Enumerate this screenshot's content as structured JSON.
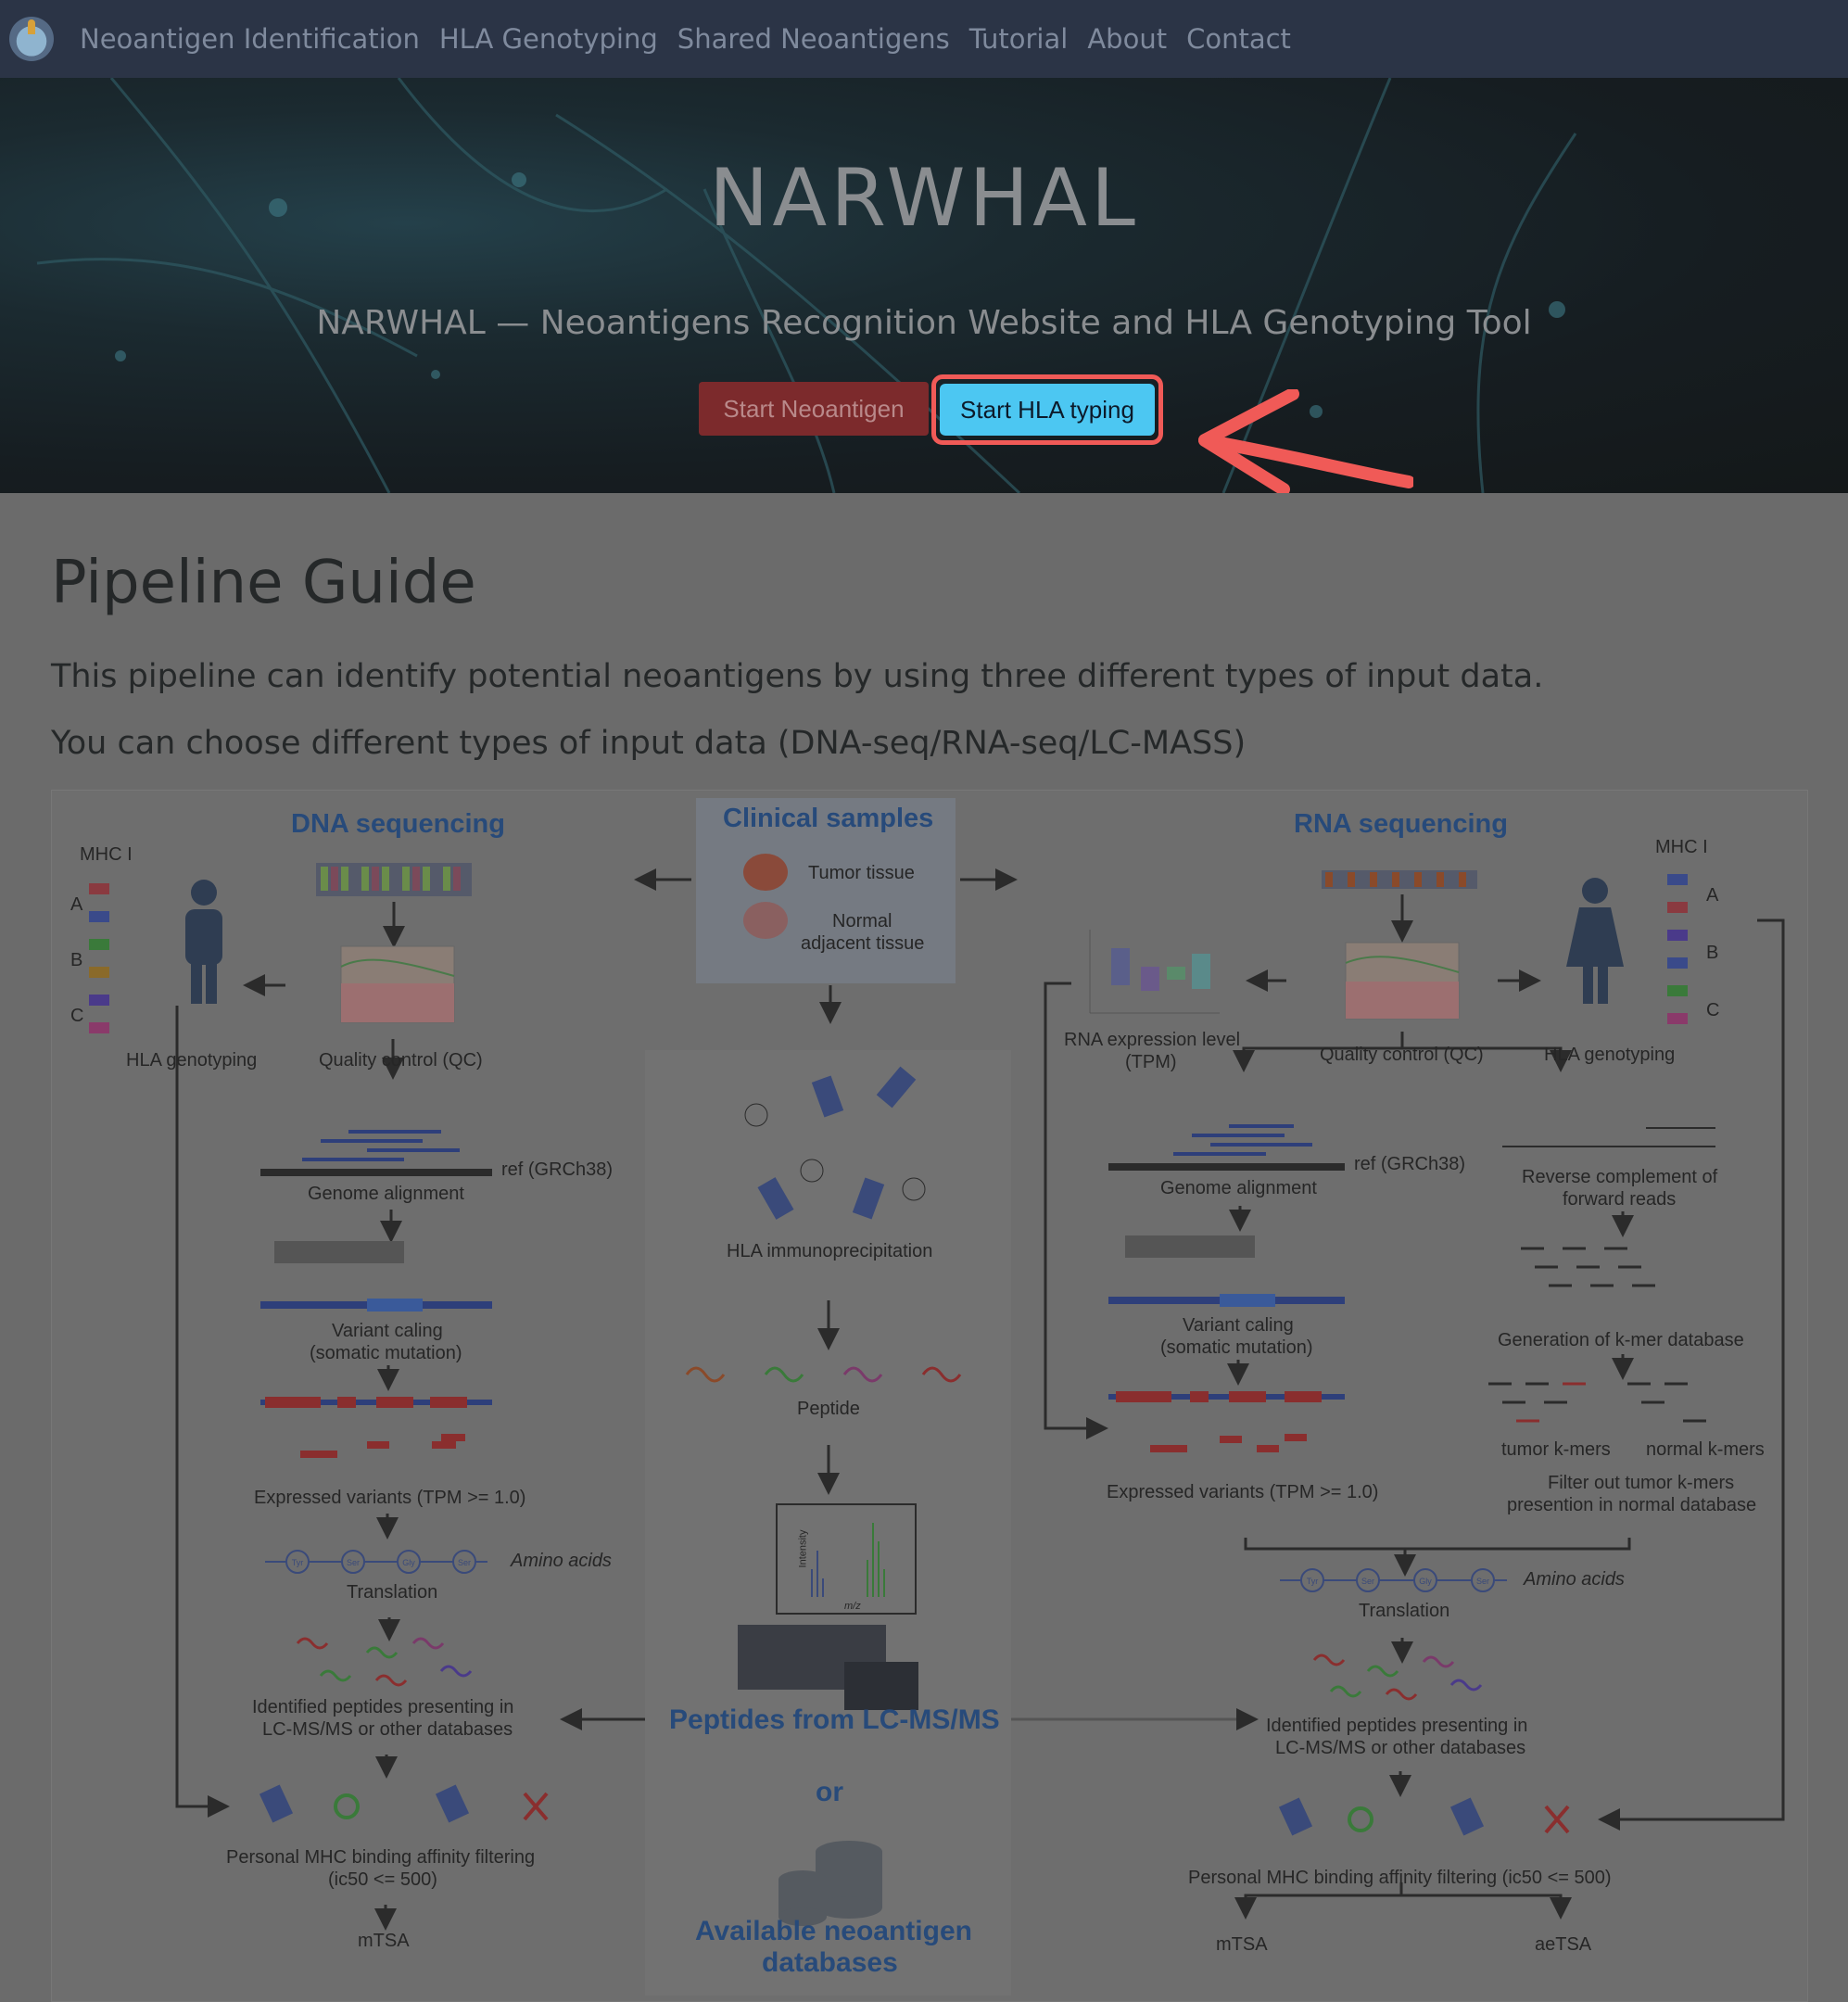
{
  "nav": {
    "items": [
      "Neoantigen Identification",
      "HLA Genotyping",
      "Shared Neoantigens",
      "Tutorial",
      "About",
      "Contact"
    ]
  },
  "hero": {
    "title": "NARWHAL",
    "subtitle": "NARWHAL — Neoantigens Recognition Website and HLA Genotyping Tool",
    "btn_neoantigen": "Start Neoantigen",
    "btn_hla": "Start HLA typing"
  },
  "guide": {
    "title": "Pipeline Guide",
    "para1": "This pipeline can identify potential neoantigens by using three different types of input data.",
    "para2": "You can choose different types of input data (DNA-seq/RNA-seq/LC-MASS)"
  },
  "diagram": {
    "dna": {
      "heading": "DNA sequencing",
      "mhc": "MHC I",
      "allele_a": "A",
      "allele_b": "B",
      "allele_c": "C",
      "hla_genotyping": "HLA genotyping",
      "qc": "Quality control (QC)",
      "ref": "ref (GRCh38)",
      "genome_alignment": "Genome alignment",
      "variant_calling": "Variant caling",
      "somatic": "(somatic mutation)",
      "expressed": "Expressed variants (TPM >= 1.0)",
      "amino_acids": "Amino acids",
      "translation": "Translation",
      "identified1": "Identified peptides presenting in",
      "identified2": "LC-MS/MS or other databases",
      "mhc_filter1": "Personal MHC binding affinity filtering",
      "mhc_filter2": "(ic50 <= 500)",
      "mtsa": "mTSA"
    },
    "center": {
      "heading": "Clinical samples",
      "tumor": "Tumor tissue",
      "normal1": "Normal",
      "normal2": "adjacent tissue",
      "hla_ip": "HLA immunoprecipitation",
      "peptide": "Peptide",
      "lcms": "Peptides from LC-MS/MS",
      "or": "or",
      "db1": "Available neoantigen",
      "db2": "databases",
      "axis_y": "Intensity",
      "axis_x": "m/z"
    },
    "rna": {
      "heading": "RNA sequencing",
      "mhc": "MHC I",
      "allele_a": "A",
      "allele_b": "B",
      "allele_c": "C",
      "rna_expr1": "RNA expression level",
      "rna_expr2": "(TPM)",
      "qc": "Quality control (QC)",
      "hla_genotyping": "HLA genotyping",
      "ref": "ref (GRCh38)",
      "genome_alignment": "Genome alignment",
      "revcomp1": "Reverse complement of",
      "revcomp2": "forward reads",
      "variant_calling": "Variant caling",
      "somatic": "(somatic mutation)",
      "kmer_db": "Generation of k-mer database",
      "tumor_kmers": "tumor k-mers",
      "normal_kmers": "normal k-mers",
      "filter1": "Filter out tumor k-mers",
      "filter2": "presention in normal database",
      "expressed": "Expressed variants (TPM >= 1.0)",
      "amino_acids": "Amino acids",
      "translation": "Translation",
      "identified1": "Identified peptides presenting in",
      "identified2": "LC-MS/MS or other databases",
      "mhc_filter": "Personal MHC binding affinity filtering (ic50 <= 500)",
      "mtsa": "mTSA",
      "aetsa": "aeTSA"
    },
    "aa": [
      "Tyr",
      "Ser",
      "Gly",
      "Ser"
    ]
  }
}
